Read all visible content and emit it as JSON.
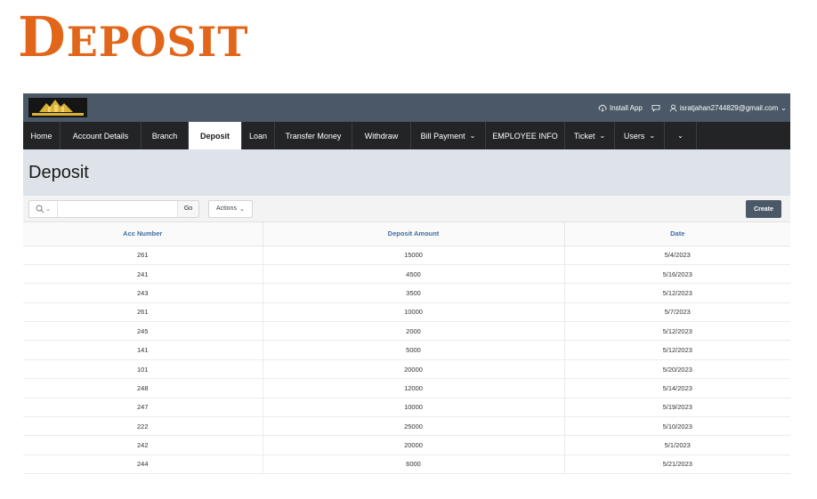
{
  "slide": {
    "title_first": "D",
    "title_rest": "EPOSIT"
  },
  "topbar": {
    "install_label": "Install App",
    "user_email": "isratjahan2744829@gmail.com"
  },
  "nav": {
    "items": [
      {
        "label": "Home"
      },
      {
        "label": "Account Details"
      },
      {
        "label": "Branch"
      },
      {
        "label": "Deposit"
      },
      {
        "label": "Loan"
      },
      {
        "label": "Transfer Money"
      },
      {
        "label": "Withdraw"
      },
      {
        "label": "Bill Payment"
      },
      {
        "label": "EMPLOYEE INFO"
      },
      {
        "label": "Ticket"
      },
      {
        "label": "Users"
      }
    ],
    "chevron": "⌄"
  },
  "page": {
    "title": "Deposit"
  },
  "toolbar": {
    "search_value": "",
    "go_label": "Go",
    "actions_label": "Actions",
    "create_label": "Create"
  },
  "table": {
    "headers": [
      "Acc Number",
      "Deposit Amount",
      "Date"
    ],
    "rows": [
      [
        "261",
        "15000",
        "5/4/2023"
      ],
      [
        "241",
        "4500",
        "5/16/2023"
      ],
      [
        "243",
        "3500",
        "5/12/2023"
      ],
      [
        "261",
        "10000",
        "5/7/2023"
      ],
      [
        "245",
        "2000",
        "5/12/2023"
      ],
      [
        "141",
        "5000",
        "5/12/2023"
      ],
      [
        "101",
        "20000",
        "5/20/2023"
      ],
      [
        "248",
        "12000",
        "5/14/2023"
      ],
      [
        "247",
        "10000",
        "5/19/2023"
      ],
      [
        "222",
        "25000",
        "5/10/2023"
      ],
      [
        "242",
        "20000",
        "5/1/2023"
      ],
      [
        "244",
        "6000",
        "5/21/2023"
      ]
    ]
  }
}
